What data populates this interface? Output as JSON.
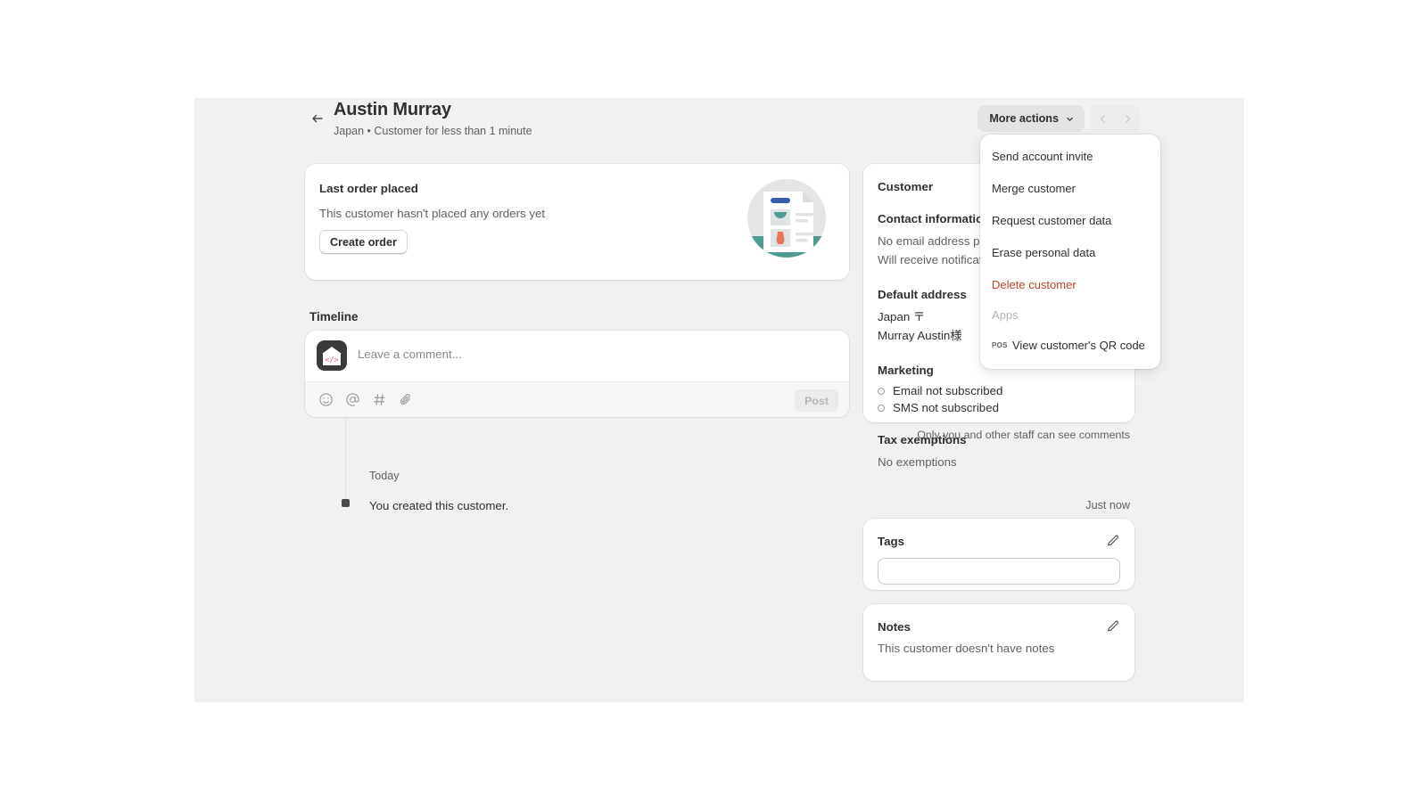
{
  "header": {
    "back_icon": "arrow-left-icon",
    "title": "Austin Murray",
    "subtitle": "Japan • Customer for less than 1 minute",
    "more_actions_label": "More actions",
    "chevron_icon": "chevron-down-icon",
    "prev_icon": "chevron-left-icon",
    "next_icon": "chevron-right-icon"
  },
  "more_actions_menu": {
    "items": [
      {
        "label": "Send account invite",
        "danger": false
      },
      {
        "label": "Merge customer",
        "danger": false
      },
      {
        "label": "Request customer data",
        "danger": false
      },
      {
        "label": "Erase personal data",
        "danger": false
      },
      {
        "label": "Delete customer",
        "danger": true
      }
    ],
    "section_label": "Apps",
    "app_item": {
      "badge": "POS",
      "label": "View customer's QR code"
    }
  },
  "last_order": {
    "title": "Last order placed",
    "message": "This customer hasn't placed any orders yet",
    "button": "Create order",
    "illustration": "empty-order-illustration"
  },
  "timeline": {
    "title": "Timeline",
    "avatar_icon": "store-code-avatar",
    "placeholder": "Leave a comment...",
    "tools": [
      "emoji-icon",
      "mention-icon",
      "hashtag-icon",
      "attachment-icon"
    ],
    "post_label": "Post",
    "privacy_note": "Only you and other staff can see comments",
    "day_label": "Today",
    "event_text": "You created this customer.",
    "event_time": "Just now"
  },
  "customer_panel": {
    "title": "Customer",
    "contact_heading": "Contact information",
    "contact_line1": "No email address provided",
    "contact_line2": "Will receive notifications in Japanese",
    "address_heading": "Default address",
    "address_line1": "Japan 〒",
    "address_line2": "Murray Austin様",
    "marketing_heading": "Marketing",
    "marketing_email": "Email not subscribed",
    "marketing_sms": "SMS not subscribed",
    "tax_heading": "Tax exemptions",
    "tax_value": "No exemptions"
  },
  "tags": {
    "title": "Tags",
    "edit_icon": "pencil-icon",
    "value": "",
    "placeholder": ""
  },
  "notes": {
    "title": "Notes",
    "edit_icon": "pencil-icon",
    "empty_text": "This customer doesn't have notes"
  },
  "colors": {
    "page_bg": "#f1f1f1",
    "card_bg": "#ffffff",
    "text_primary": "#303030",
    "text_secondary": "#616161",
    "danger": "#c0442e",
    "button_bg": "#e3e3e3",
    "accent_teal": "#4f9a93"
  }
}
